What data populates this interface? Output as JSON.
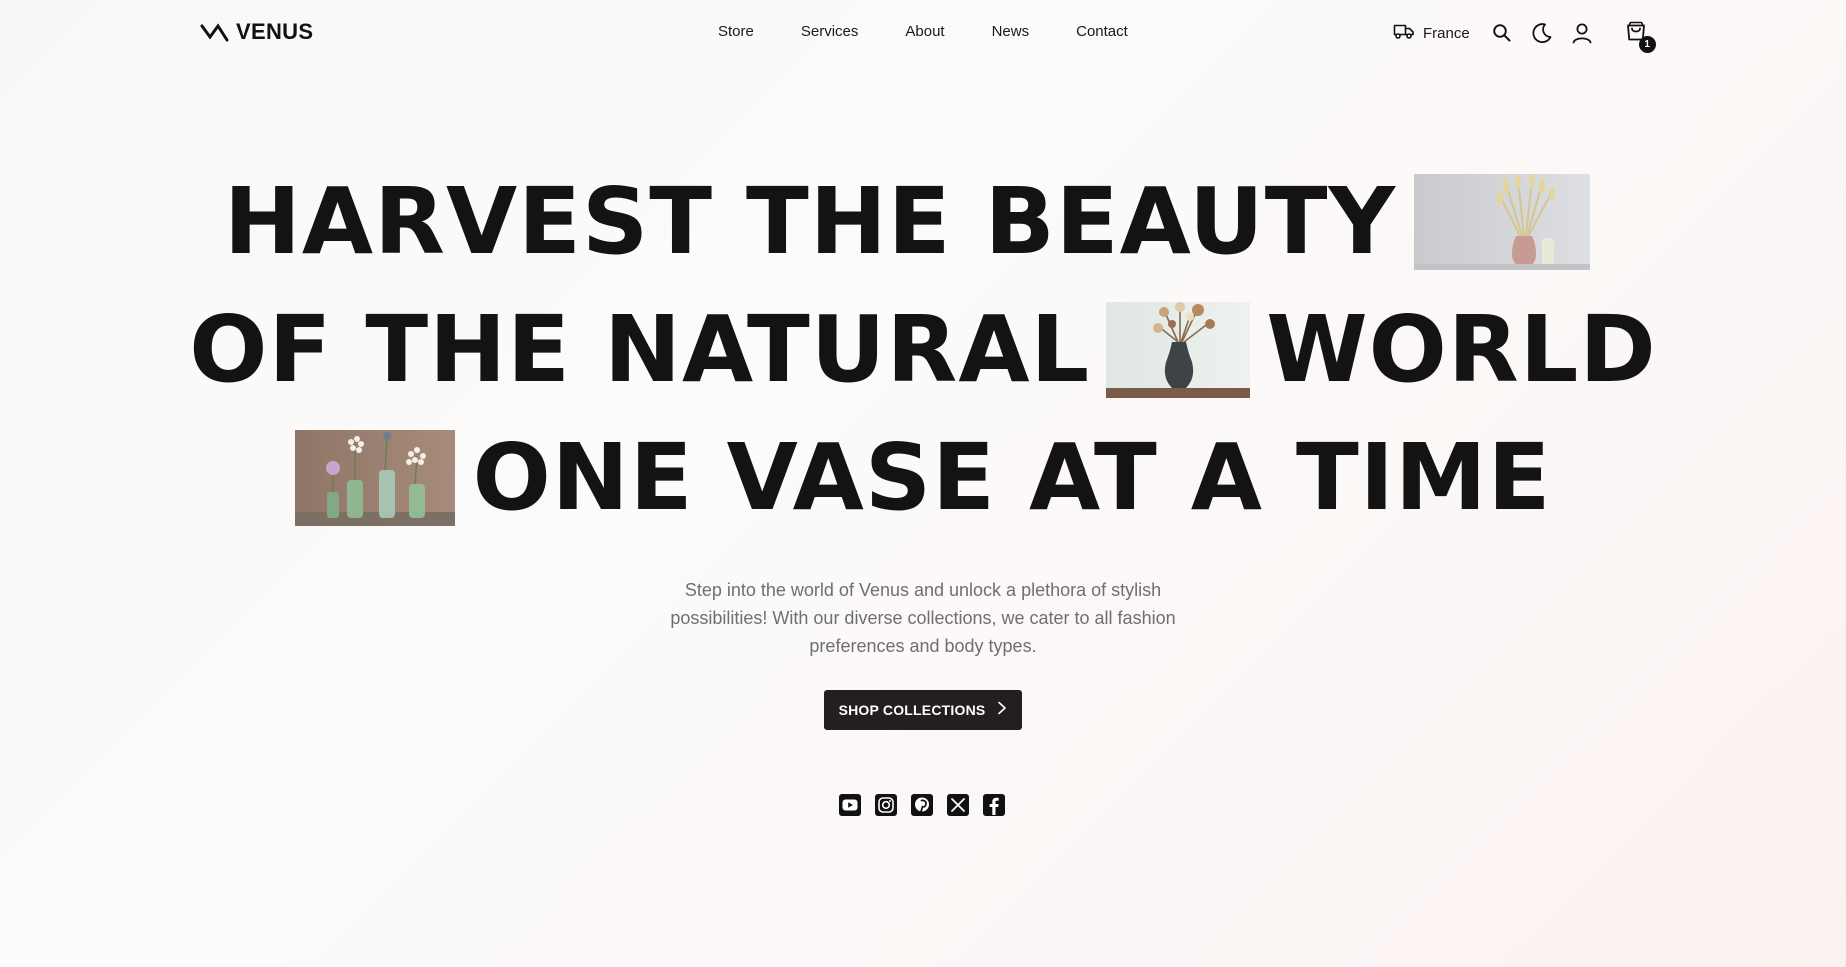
{
  "brand": {
    "name": "VENUS",
    "logo_icon": "zigzag-wave-icon"
  },
  "nav": {
    "items": [
      {
        "label": "Store"
      },
      {
        "label": "Services"
      },
      {
        "label": "About"
      },
      {
        "label": "News"
      },
      {
        "label": "Contact"
      }
    ]
  },
  "header": {
    "region_label": "France",
    "region_icon": "truck-icon",
    "search_icon": "search-icon",
    "theme_icon": "moon-icon",
    "account_icon": "user-icon",
    "cart_icon": "shopping-bag-icon",
    "cart_count": "1"
  },
  "hero": {
    "line1": "HARVEST THE BEAUTY",
    "line2a": "OF THE NATURAL",
    "line2b": "WORLD",
    "line3": "ONE VASE AT A TIME",
    "images": [
      {
        "name": "dried-grass-pink-vase-image"
      },
      {
        "name": "dried-flowers-dark-vase-image"
      },
      {
        "name": "green-bottles-wildflowers-image"
      }
    ],
    "subtitle": "Step into the world of Venus and unlock a plethora of stylish possibilities! With our diverse collections, we cater to all fashion preferences and body types.",
    "cta_label": "SHOP COLLECTIONS",
    "cta_icon": "chevron-right-icon"
  },
  "socials": [
    {
      "name": "youtube-icon"
    },
    {
      "name": "instagram-icon"
    },
    {
      "name": "pinterest-icon"
    },
    {
      "name": "x-icon"
    },
    {
      "name": "facebook-icon"
    }
  ],
  "colors": {
    "text": "#131313",
    "muted": "#6f6f6f",
    "cta_bg": "#231f1f",
    "background": "#fbf9f8"
  }
}
